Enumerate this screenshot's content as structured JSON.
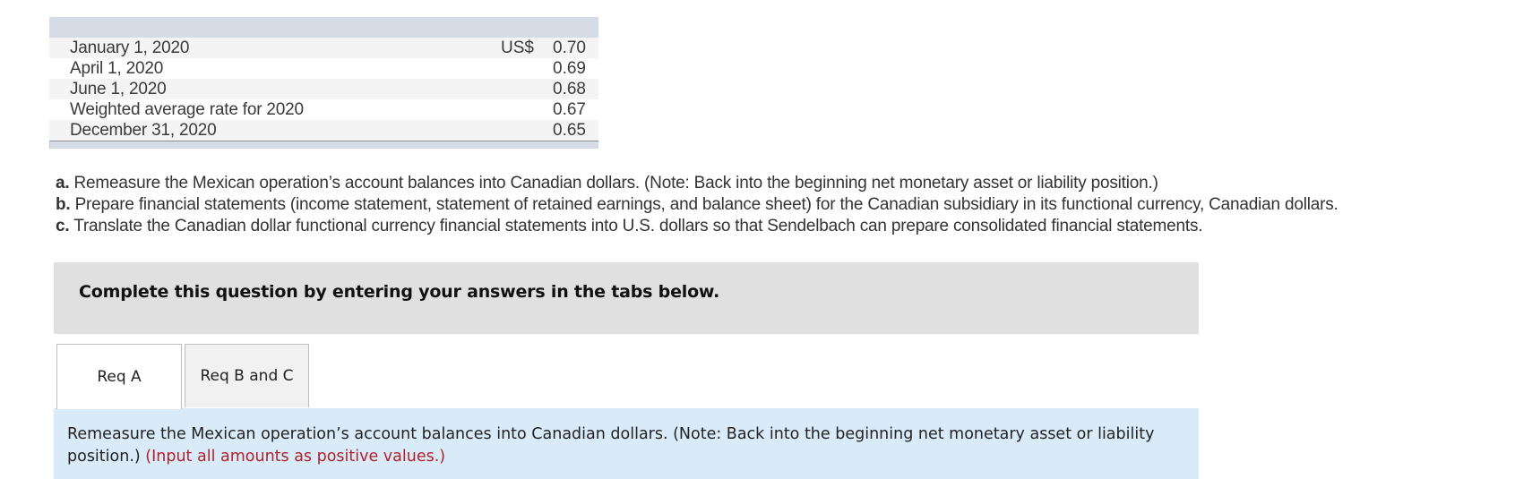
{
  "rates_table": {
    "currency_label": "US$",
    "rows": [
      {
        "label": "January 1, 2020",
        "currency": "US$",
        "value": "0.70"
      },
      {
        "label": "April 1, 2020",
        "currency": "",
        "value": "0.69"
      },
      {
        "label": "June 1, 2020",
        "currency": "",
        "value": "0.68"
      },
      {
        "label": "Weighted average rate for 2020",
        "currency": "",
        "value": "0.67"
      },
      {
        "label": "December 31, 2020",
        "currency": "",
        "value": "0.65"
      }
    ]
  },
  "requirements": [
    {
      "letter": "a.",
      "text": " Remeasure the Mexican operation’s account balances into Canadian dollars. (Note: Back into the beginning net monetary asset or liability position.)"
    },
    {
      "letter": "b.",
      "text": " Prepare financial statements (income statement, statement of retained earnings, and balance sheet) for the Canadian subsidiary in its functional currency, Canadian dollars."
    },
    {
      "letter": "c.",
      "text": " Translate the Canadian dollar functional currency financial statements into U.S. dollars so that Sendelbach can prepare consolidated financial statements."
    }
  ],
  "banner": {
    "text": "Complete this question by entering your answers in the tabs below."
  },
  "tabs": [
    {
      "label": "Req A",
      "active": true
    },
    {
      "label": "Req B and C",
      "active": false
    }
  ],
  "panel": {
    "instruction": "Remeasure the Mexican operation’s account balances into Canadian dollars. (Note: Back into the beginning net monetary asset or liability position.) ",
    "note": "(Input all amounts as positive values.)",
    "note_color": "#b0232b"
  }
}
